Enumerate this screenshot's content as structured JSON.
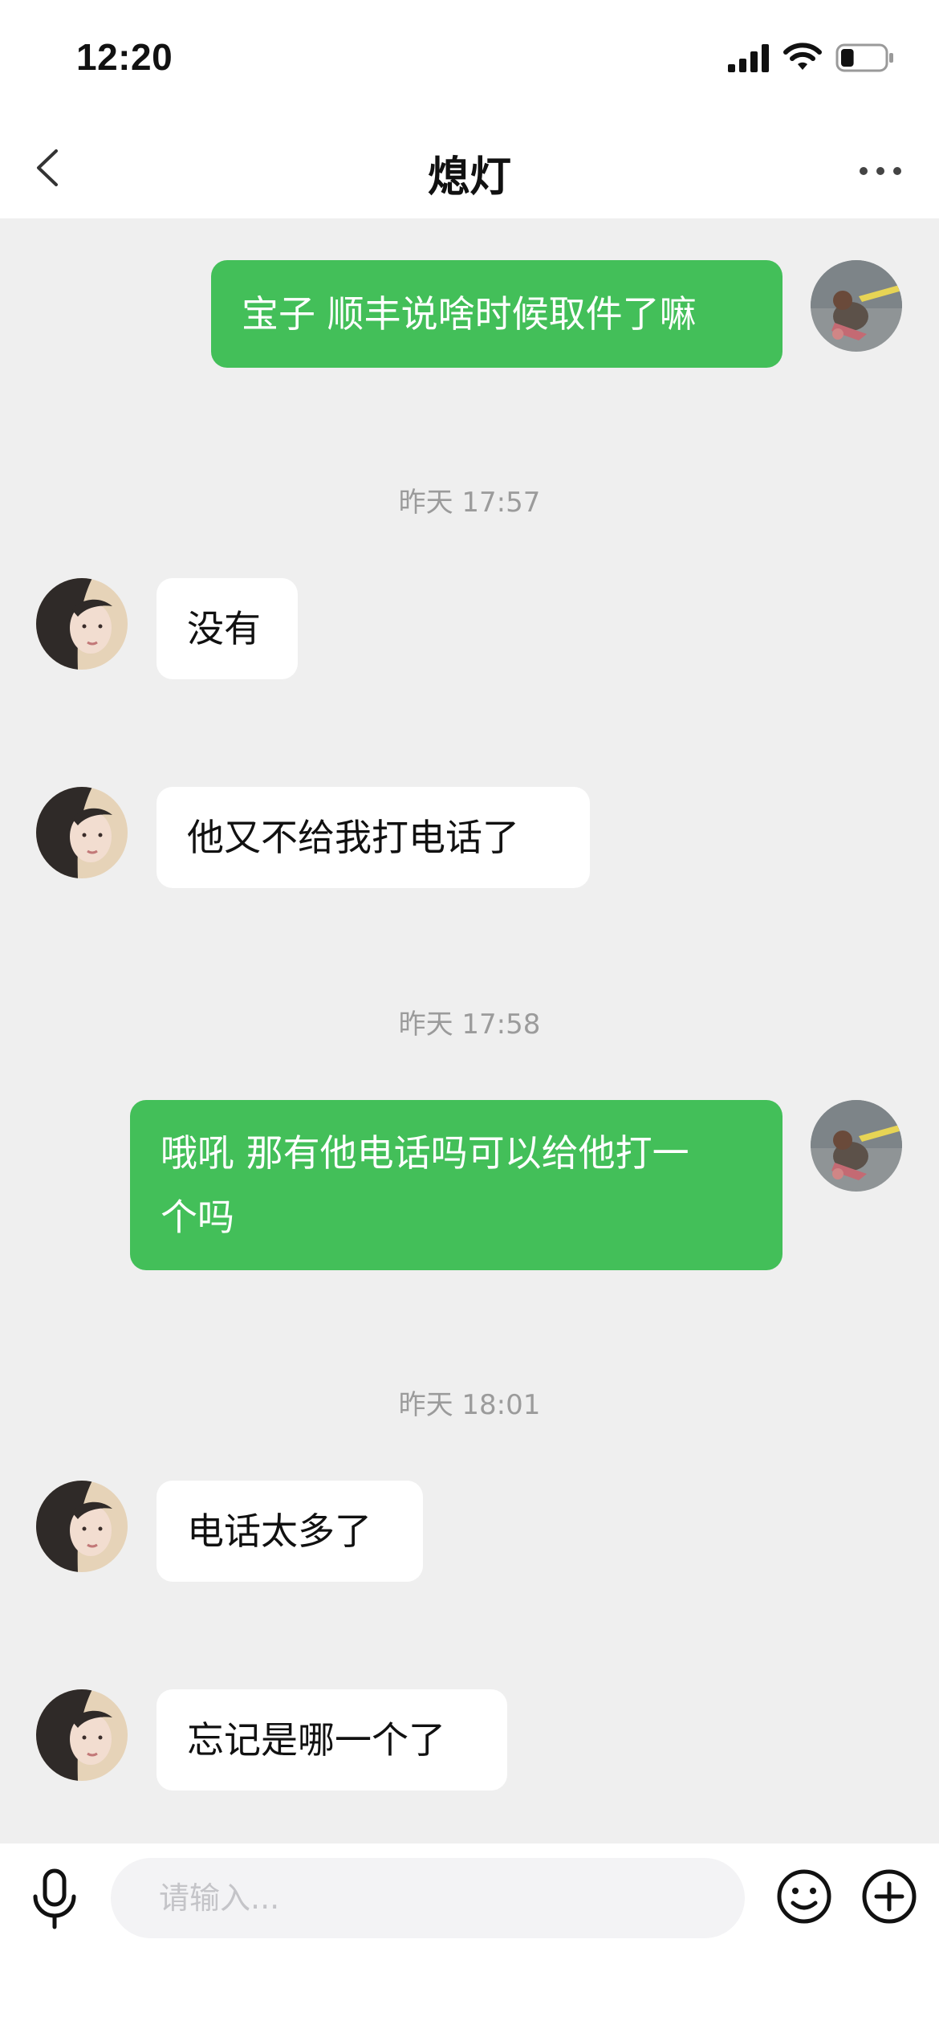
{
  "status_bar": {
    "time": "12:20",
    "battery_level_percent": 30
  },
  "header": {
    "title": "熄灯",
    "back_icon": "chevron-left-icon",
    "more_icon": "ellipsis-icon"
  },
  "messages": [
    {
      "type": "text",
      "side": "out",
      "text": "宝子 顺丰说啥时候取件了嘛"
    },
    {
      "type": "timestamp",
      "text": "昨天 17:57"
    },
    {
      "type": "text",
      "side": "in",
      "text": "没有"
    },
    {
      "type": "text",
      "side": "in",
      "text": "他又不给我打电话了"
    },
    {
      "type": "timestamp",
      "text": "昨天 17:58"
    },
    {
      "type": "text",
      "side": "out",
      "line1": "哦吼 那有他电话吗可以给他打一",
      "line2": "个吗"
    },
    {
      "type": "timestamp",
      "text": "昨天 18:01"
    },
    {
      "type": "text",
      "side": "in",
      "text": "电话太多了"
    },
    {
      "type": "text",
      "side": "in",
      "text": "忘记是哪一个了"
    }
  ],
  "input_bar": {
    "placeholder": "请输入...",
    "icons": [
      "microphone-icon",
      "emoji-icon",
      "add-icon"
    ]
  },
  "colors": {
    "outgoing_bubble": "#43bf59",
    "incoming_bubble": "#ffffff",
    "background": "#efefef"
  }
}
